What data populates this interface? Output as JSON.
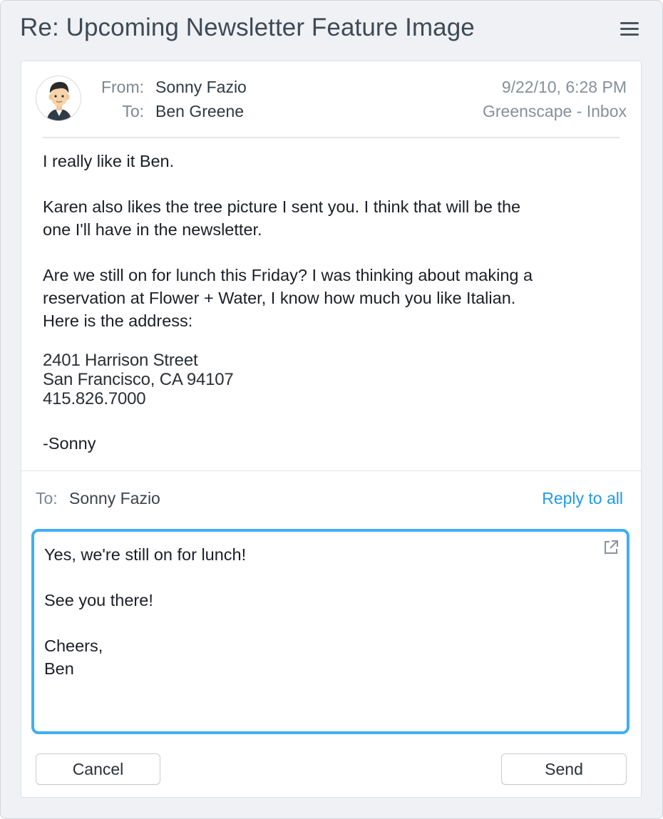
{
  "window": {
    "title": "Re: Upcoming Newsletter Feature Image",
    "menu_icon": "hamburger-menu-icon"
  },
  "message": {
    "from_label": "From:",
    "from_name": "Sonny Fazio",
    "to_label": "To:",
    "to_name": "Ben Greene",
    "date": "9/22/10, 6:28 PM",
    "mailbox": "Greenscape - Inbox",
    "avatar": "person-avatar",
    "body": {
      "p1": "I really like it Ben.",
      "p2": "Karen also likes the tree picture I sent you.  I think that will be the\none I'll have in the newsletter.",
      "p3": "Are we still on for lunch this Friday? I was thinking about making a\nreservation at Flower + Water, I know how much you like Italian.\nHere is the address:",
      "address": "2401 Harrison Street\nSan Francisco, CA  94107\n415.826.7000",
      "signoff": "-Sonny"
    }
  },
  "reply": {
    "to_label": "To:",
    "to_name": "Sonny Fazio",
    "reply_all_label": "Reply to all",
    "text": "Yes, we're still on for lunch!\n\nSee you there!\n\nCheers,\nBen",
    "popout_icon": "popout-icon"
  },
  "actions": {
    "cancel_label": "Cancel",
    "send_label": "Send"
  },
  "colors": {
    "accent": "#40aef3",
    "link": "#1e9be9",
    "background": "#eff1f5"
  }
}
